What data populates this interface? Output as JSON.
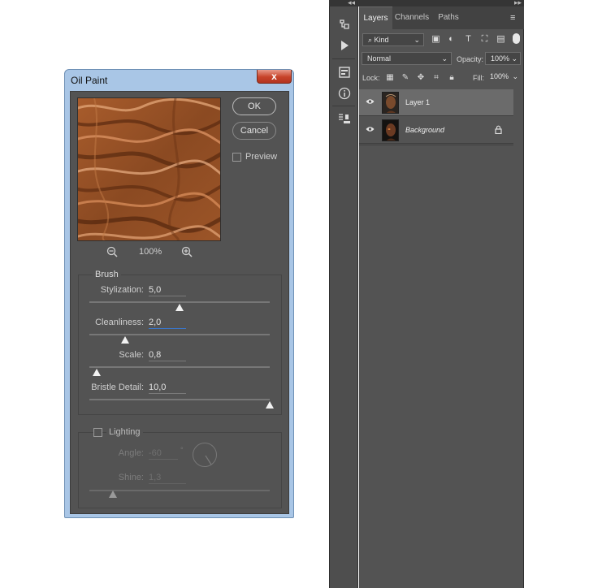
{
  "dialog": {
    "title": "Oil Paint",
    "close_label": "x",
    "ok_label": "OK",
    "cancel_label": "Cancel",
    "preview_label": "Preview",
    "preview_checked": false,
    "zoom_level": "100%",
    "brush_title": "Brush",
    "brush": {
      "stylization": {
        "label": "Stylization:",
        "value": "5,0",
        "fraction": 0.5
      },
      "cleanliness": {
        "label": "Cleanliness:",
        "value": "2,0",
        "fraction": 0.2
      },
      "scale": {
        "label": "Scale:",
        "value": "0,8",
        "fraction": 0.04
      },
      "bristle": {
        "label": "Bristle Detail:",
        "value": "10,0",
        "fraction": 1.0
      }
    },
    "lighting": {
      "label": "Lighting",
      "checked": false,
      "angle": {
        "label": "Angle:",
        "value": "-60",
        "unit": "°"
      },
      "shine": {
        "label": "Shine:",
        "value": "1,3",
        "fraction": 0.13
      }
    }
  },
  "panels": {
    "collapse_left": "◂◂",
    "collapse_right": "▸▸",
    "tabs": [
      "Layers",
      "Channels",
      "Paths"
    ],
    "menu_icon": "≡",
    "filter_kind": "Kind",
    "blend_mode": "Normal",
    "opacity_label": "Opacity:",
    "opacity_value": "100%",
    "lock_label": "Lock:",
    "fill_label": "Fill:",
    "fill_value": "100%",
    "layers": [
      {
        "name": "Layer 1",
        "visible": true,
        "selected": true,
        "locked": false
      },
      {
        "name": "Background",
        "visible": true,
        "selected": false,
        "locked": true
      }
    ]
  },
  "colors": {
    "dialog_frame": "#a9c6e6",
    "dialog_body": "#535353",
    "panel_bg": "#535353",
    "selected_layer": "#6b6b6b",
    "preview_texture": "#8b4a22"
  }
}
